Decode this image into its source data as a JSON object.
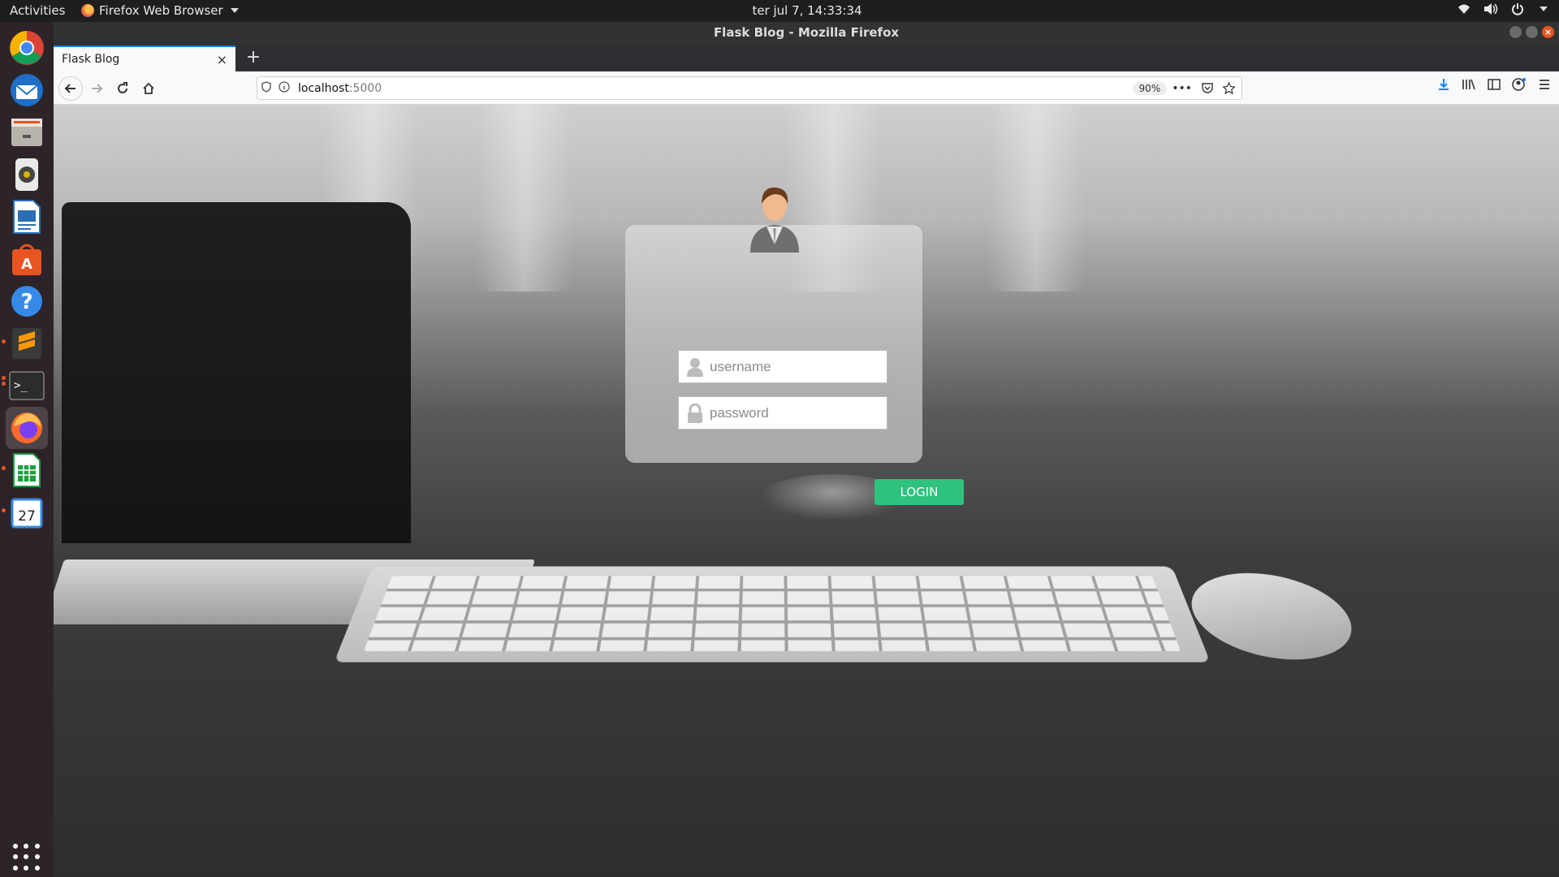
{
  "topbar": {
    "activities": "Activities",
    "app_menu": "Firefox Web Browser",
    "clock": "ter jul  7, 14:33:34",
    "tray_icons": [
      "wifi-icon",
      "volume-icon",
      "power-icon"
    ]
  },
  "dock": {
    "items": [
      "chrome-icon",
      "thunderbird-icon",
      "files-icon",
      "rhythmbox-icon",
      "libreoffice-writer-icon",
      "software-center-icon",
      "help-icon",
      "sublime-text-icon",
      "terminal-icon",
      "firefox-icon",
      "libreoffice-calc-icon",
      "calendar-icon"
    ],
    "calendar_day": "27",
    "active": "firefox-icon"
  },
  "window": {
    "title": "Flask Blog - Mozilla Firefox"
  },
  "tab": {
    "title": "Flask Blog",
    "close": "×",
    "new": "+"
  },
  "urlbar": {
    "host": "localhost",
    "port": ":5000",
    "zoom": "90%"
  },
  "login": {
    "username_placeholder": "username",
    "password_placeholder": "password",
    "button": "LOGIN"
  },
  "colors": {
    "accent": "#2ec27e",
    "ubuntu_orange": "#e95420",
    "firefox_blue": "#0a84ff"
  }
}
